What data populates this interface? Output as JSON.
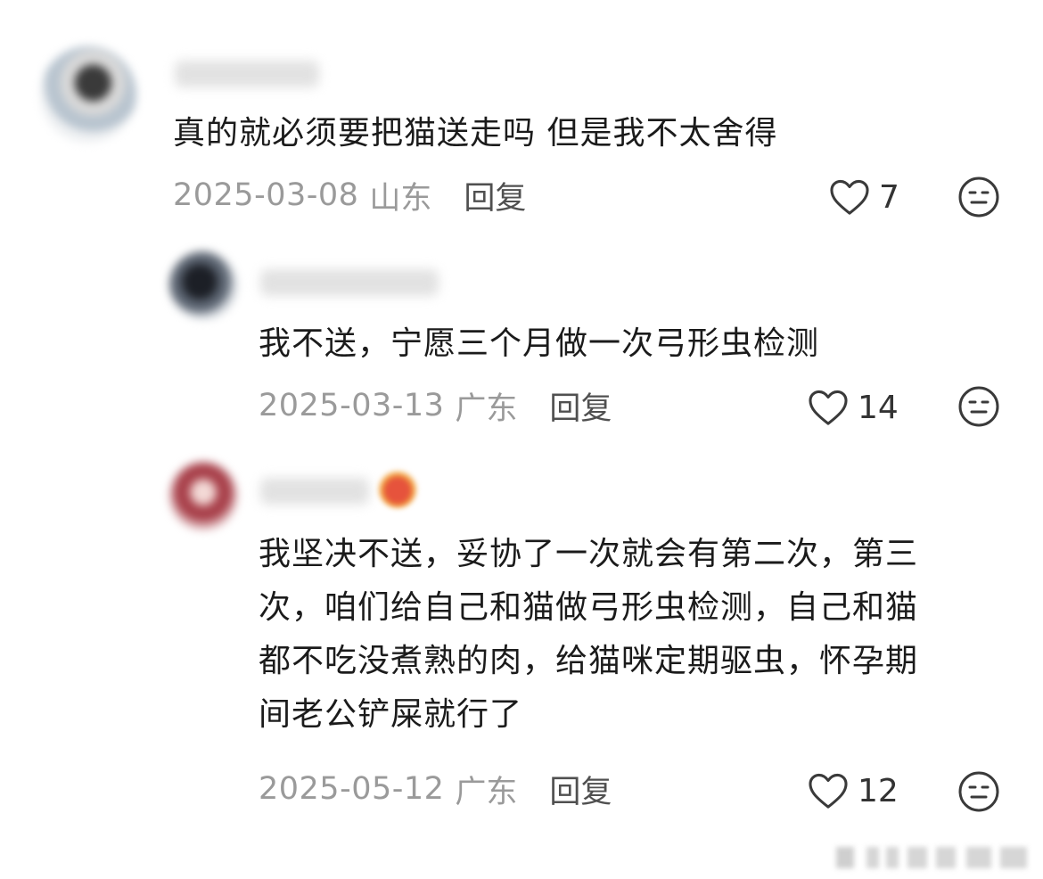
{
  "comments": [
    {
      "text_lines": [
        "真的就必须要把猫送走吗 但是我不太舍得"
      ],
      "date": "2025-03-08",
      "region": "山东",
      "reply_label": "回复",
      "likes": "7"
    },
    {
      "text_lines": [
        "我不送，宁愿三个月做一次弓形虫检测"
      ],
      "date": "2025-03-13",
      "region": "广东",
      "reply_label": "回复",
      "likes": "14"
    },
    {
      "text_lines": [
        "我坚决不送，妥协了一次就会有第二次，第三",
        "次，咱们给自己和猫做弓形虫检测，自己和猫",
        "都不吃没煮熟的肉，给猫咪定期驱虫，怀孕期",
        "间老公铲屎就行了"
      ],
      "date": "2025-05-12",
      "region": "广东",
      "reply_label": "回复",
      "likes": "12"
    }
  ],
  "icons": {
    "like": "heart-outline-icon",
    "dislike": "neutral-face-icon"
  },
  "colors": {
    "meta_text": "#9a9a9a",
    "reply_text": "#505050",
    "body_text": "#1b1b1b"
  }
}
